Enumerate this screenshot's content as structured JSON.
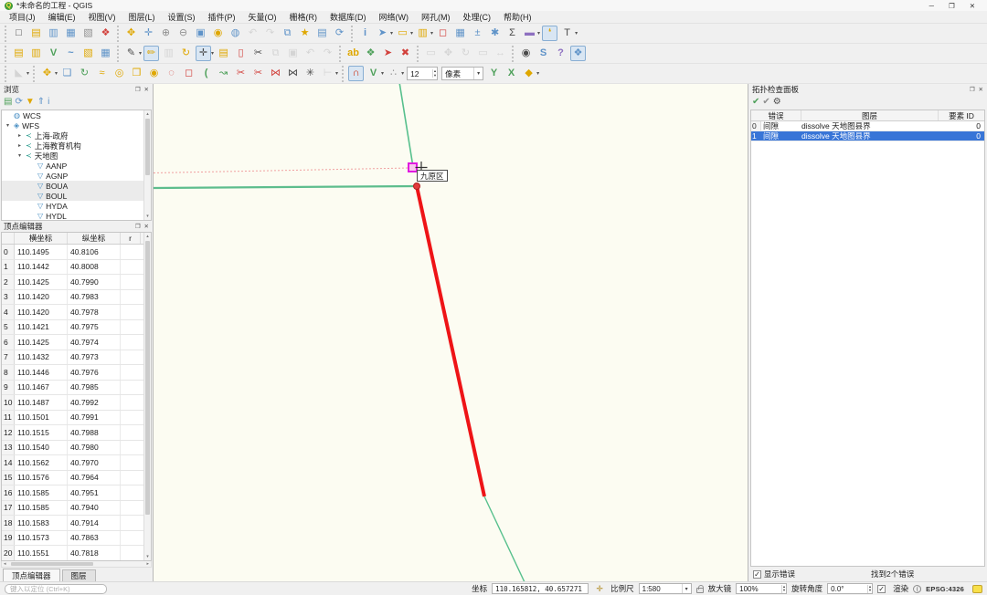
{
  "window": {
    "title": "*未命名的工程 - QGIS",
    "controls": {
      "minimize": "─",
      "maximize": "❐",
      "close": "✕"
    }
  },
  "ui": {
    "dropdown": "▾",
    "up": "▴",
    "down": "▾",
    "left": "◂",
    "right": "▸",
    "expander_open": "▾",
    "expander_closed": "▸",
    "check": "✓",
    "float_glyph": "❐",
    "close_glyph": "✕"
  },
  "palette": {
    "yellow": "#dfa700",
    "blue": "#5f93c8",
    "gray": "#9c9c9c",
    "gray2": "#8f8f8f",
    "dark": "#4a4a4a",
    "red": "#d2413c",
    "red2": "#cc2200",
    "green": "#4ea05a",
    "purple": "#8d6fc0",
    "magenta": "#e01ae0",
    "accent_selection": "#3875d7"
  },
  "menu_bar": [
    "项目(J)",
    "编辑(E)",
    "视图(V)",
    "图层(L)",
    "设置(S)",
    "插件(P)",
    "矢量(O)",
    "栅格(R)",
    "数据库(D)",
    "网络(W)",
    "网孔(M)",
    "处理(C)",
    "帮助(H)"
  ],
  "toolbars": {
    "row1": [
      {
        "name": "project",
        "items": [
          {
            "n": "new-project",
            "g": "□",
            "c": "dark"
          },
          {
            "n": "open-project",
            "g": "▤",
            "c": "yellow"
          },
          {
            "n": "save-project",
            "g": "▥",
            "c": "blue"
          },
          {
            "n": "save-project-as",
            "g": "▦",
            "c": "blue"
          },
          {
            "n": "new-print-layout",
            "g": "▧",
            "c": "gray2"
          },
          {
            "n": "style-manager",
            "g": "❖",
            "c": "red"
          }
        ]
      },
      {
        "name": "navigation",
        "items": [
          {
            "n": "pan-map",
            "g": "✥",
            "c": "yellow"
          },
          {
            "n": "pan-to-selection",
            "g": "✛",
            "c": "blue"
          },
          {
            "n": "zoom-in",
            "g": "⊕",
            "c": "gray2"
          },
          {
            "n": "zoom-out",
            "g": "⊖",
            "c": "gray2"
          },
          {
            "n": "zoom-full",
            "g": "▣",
            "c": "blue"
          },
          {
            "n": "zoom-to-selection",
            "g": "◉",
            "c": "yellow"
          },
          {
            "n": "zoom-to-layer",
            "g": "◍",
            "c": "blue"
          },
          {
            "n": "zoom-last",
            "g": "↶",
            "c": "gray",
            "d": 1
          },
          {
            "n": "zoom-next",
            "g": "↷",
            "c": "gray",
            "d": 1
          },
          {
            "n": "new-map-view",
            "g": "⧉",
            "c": "blue"
          },
          {
            "n": "new-spatial-bookmark",
            "g": "★",
            "c": "yellow"
          },
          {
            "n": "show-bookmarks",
            "g": "▤",
            "c": "blue"
          },
          {
            "n": "refresh-map",
            "g": "⟳",
            "c": "blue"
          }
        ]
      },
      {
        "name": "attributes",
        "items": [
          {
            "n": "identify-features",
            "g": "i",
            "c": "blue",
            "b": 1
          },
          {
            "n": "run-feature-action",
            "g": "➤",
            "c": "blue",
            "dd": 1
          },
          {
            "n": "select-features",
            "g": "▭",
            "c": "yellow",
            "dd": 1
          },
          {
            "n": "select-by-value",
            "g": "▥",
            "c": "yellow",
            "dd": 1
          },
          {
            "n": "deselect-features",
            "g": "◻",
            "c": "red"
          },
          {
            "n": "open-attribute-table",
            "g": "▦",
            "c": "blue"
          },
          {
            "n": "field-calculator",
            "g": "±",
            "c": "blue"
          },
          {
            "n": "processing-toolbox",
            "g": "✱",
            "c": "blue"
          },
          {
            "n": "statistics-panel",
            "g": "Σ",
            "c": "dark"
          },
          {
            "n": "measure",
            "g": "▬",
            "c": "purple",
            "dd": 1
          },
          {
            "n": "map-tips",
            "g": "❛",
            "c": "yellow",
            "a": 1
          },
          {
            "n": "text-annotation",
            "g": "T",
            "c": "dark",
            "dd": 1
          }
        ]
      }
    ],
    "row2": [
      {
        "name": "data-source",
        "items": [
          {
            "n": "new-geopackage-layer",
            "g": "▤",
            "c": "yellow"
          },
          {
            "n": "new-shapefile-layer",
            "g": "▥",
            "c": "yellow"
          },
          {
            "n": "new-virtual-layer",
            "g": "V",
            "c": "green",
            "b": 1
          },
          {
            "n": "new-spatialite-layer",
            "g": "~",
            "c": "blue",
            "b": 1
          },
          {
            "n": "new-temporary-scratch-layer",
            "g": "▧",
            "c": "yellow"
          },
          {
            "n": "new-mesh-layer",
            "g": "▦",
            "c": "blue"
          }
        ]
      },
      {
        "name": "digitizing",
        "items": [
          {
            "n": "current-edits",
            "g": "✎",
            "c": "dark",
            "dd": 1
          },
          {
            "n": "toggle-editing",
            "g": "✏",
            "c": "yellow",
            "a": 1
          },
          {
            "n": "save-layer-edits",
            "g": "▥",
            "c": "gray",
            "d": 1
          },
          {
            "n": "add-line-feature",
            "g": "↻",
            "c": "yellow"
          },
          {
            "n": "vertex-tool",
            "g": "✛",
            "c": "dark",
            "a": 1,
            "dd": 1
          },
          {
            "n": "modify-attributes",
            "g": "▤",
            "c": "yellow"
          },
          {
            "n": "delete-selected",
            "g": "▯",
            "c": "red",
            "b": 1
          },
          {
            "n": "cut-features",
            "g": "✂",
            "c": "dark"
          },
          {
            "n": "copy-features",
            "g": "⧉",
            "c": "gray",
            "d": 1
          },
          {
            "n": "paste-features",
            "g": "▣",
            "c": "gray",
            "d": 1
          },
          {
            "n": "undo",
            "g": "↶",
            "c": "gray",
            "d": 1
          },
          {
            "n": "redo",
            "g": "↷",
            "c": "gray",
            "d": 1
          }
        ]
      },
      {
        "name": "labels",
        "items": [
          {
            "n": "layer-labeling",
            "g": "ab",
            "c": "yellow",
            "b": 1
          },
          {
            "n": "layer-diagram",
            "g": "❖",
            "c": "green"
          },
          {
            "n": "pin-labels",
            "g": "➤",
            "c": "red"
          },
          {
            "n": "unpin-labels",
            "g": "✖",
            "c": "red"
          }
        ]
      },
      {
        "name": "label-tools",
        "items": [
          {
            "n": "highlight-pinned-labels",
            "g": "▭",
            "c": "gray",
            "d": 1
          },
          {
            "n": "move-label",
            "g": "✥",
            "c": "gray",
            "d": 1
          },
          {
            "n": "rotate-label",
            "g": "↻",
            "c": "gray",
            "d": 1
          },
          {
            "n": "change-label-properties",
            "g": "▭",
            "c": "gray",
            "d": 1
          },
          {
            "n": "resize-label",
            "g": "↔",
            "c": "gray",
            "d": 1
          }
        ]
      },
      {
        "name": "plugins",
        "items": [
          {
            "n": "metasearch",
            "g": "◉",
            "c": "dark"
          },
          {
            "n": "python-console",
            "g": "S",
            "c": "blue",
            "b": 1
          },
          {
            "n": "help-contents",
            "g": "?",
            "c": "purple",
            "b": 1
          },
          {
            "n": "topology-checker-plugin",
            "g": "❖",
            "c": "blue",
            "a": 1
          }
        ]
      }
    ],
    "row3": [
      {
        "name": "cad",
        "items": [
          {
            "n": "enable-cad-tools",
            "g": "◣",
            "c": "gray",
            "d": 1,
            "dd": 1
          }
        ]
      },
      {
        "name": "advanced-digitizing",
        "items": [
          {
            "n": "move-feature",
            "g": "✥",
            "c": "yellow",
            "dd": 1
          },
          {
            "n": "copy-and-move-feature",
            "g": "❏",
            "c": "blue"
          },
          {
            "n": "rotate-feature",
            "g": "↻",
            "c": "green"
          },
          {
            "n": "simplify-feature",
            "g": "≈",
            "c": "yellow"
          },
          {
            "n": "add-ring",
            "g": "◎",
            "c": "yellow"
          },
          {
            "n": "add-part",
            "g": "❒",
            "c": "yellow"
          },
          {
            "n": "fill-ring",
            "g": "◉",
            "c": "yellow"
          },
          {
            "n": "delete-ring",
            "g": "◌",
            "c": "red"
          },
          {
            "n": "delete-part",
            "g": "◻",
            "c": "red"
          },
          {
            "n": "offset-curve",
            "g": "(",
            "c": "green",
            "b": 1
          },
          {
            "n": "reshape-features",
            "g": "↝",
            "c": "green"
          },
          {
            "n": "split-parts",
            "g": "✂",
            "c": "red"
          },
          {
            "n": "split-features",
            "g": "✂",
            "c": "red"
          },
          {
            "n": "merge-features",
            "g": "⋈",
            "c": "red"
          },
          {
            "n": "merge-attributes",
            "g": "⋈",
            "c": "dark"
          },
          {
            "n": "rotate-point-symbols",
            "g": "✳",
            "c": "dark"
          },
          {
            "n": "trim-extend",
            "g": "⊢",
            "c": "gray",
            "d": 1,
            "dd": 1
          }
        ]
      },
      {
        "name": "snapping",
        "items": [
          {
            "n": "enable-snapping",
            "g": "∩",
            "c": "red2",
            "a": 1,
            "b": 1
          },
          {
            "n": "snapping-mode",
            "g": "V",
            "c": "green",
            "b": 1,
            "dd": 1
          },
          {
            "n": "snapping-tolerance-type",
            "g": "∴",
            "c": "gray2",
            "dd": 1
          },
          {
            "t": "spin",
            "n": "snapping-tolerance",
            "v": "12"
          },
          {
            "t": "combo",
            "n": "snapping-units",
            "v": "像素"
          },
          {
            "n": "topological-editing",
            "g": "Y",
            "c": "green",
            "b": 1
          },
          {
            "n": "snapping-on-intersection",
            "g": "X",
            "c": "green",
            "b": 1
          },
          {
            "n": "avoid-overlap",
            "g": "◆",
            "c": "yellow",
            "dd": 1
          }
        ]
      }
    ]
  },
  "browser": {
    "title": "浏览",
    "toolbar": [
      {
        "n": "add-selected-layers",
        "g": "▤",
        "c": "green"
      },
      {
        "n": "refresh-browser",
        "g": "⟳",
        "c": "blue"
      },
      {
        "n": "filter-browser",
        "g": "▼",
        "c": "yellow"
      },
      {
        "n": "collapse-all",
        "g": "⇑",
        "c": "blue"
      },
      {
        "n": "properties-widget",
        "g": "i",
        "c": "blue"
      }
    ],
    "icon_map": {
      "globe": {
        "g": "◍",
        "c": "#4a90c4"
      },
      "wfs": {
        "g": "◈",
        "c": "#4a90c4"
      },
      "conn": {
        "g": "≺",
        "c": "#2d9d8f"
      },
      "layer": {
        "g": "▽",
        "c": "#4a90c4"
      }
    },
    "items": [
      {
        "label": "WCS",
        "depth": 0,
        "icon": "globe",
        "exp": ""
      },
      {
        "label": "WFS",
        "depth": 0,
        "icon": "wfs",
        "exp": "open"
      },
      {
        "label": "上海-政府",
        "depth": 1,
        "icon": "conn",
        "exp": "closed"
      },
      {
        "label": "上海教育机构",
        "depth": 1,
        "icon": "conn",
        "exp": "closed"
      },
      {
        "label": "天地图",
        "depth": 1,
        "icon": "conn",
        "exp": "open"
      },
      {
        "label": "AANP",
        "depth": 2,
        "icon": "layer",
        "exp": ""
      },
      {
        "label": "AGNP",
        "depth": 2,
        "icon": "layer",
        "exp": ""
      },
      {
        "label": "BOUA",
        "depth": 2,
        "icon": "layer",
        "exp": "",
        "selected": true
      },
      {
        "label": "BOUL",
        "depth": 2,
        "icon": "layer",
        "exp": "",
        "selected": true
      },
      {
        "label": "HYDA",
        "depth": 2,
        "icon": "layer",
        "exp": ""
      },
      {
        "label": "HYDL",
        "depth": 2,
        "icon": "layer",
        "exp": ""
      }
    ]
  },
  "vertex_editor": {
    "title": "顶点编辑器",
    "columns": [
      "",
      "横坐标",
      "纵坐标",
      "r"
    ],
    "rows": [
      [
        "0",
        "110.1495",
        "40.8106"
      ],
      [
        "1",
        "110.1442",
        "40.8008"
      ],
      [
        "2",
        "110.1425",
        "40.7990"
      ],
      [
        "3",
        "110.1420",
        "40.7983"
      ],
      [
        "4",
        "110.1420",
        "40.7978"
      ],
      [
        "5",
        "110.1421",
        "40.7975"
      ],
      [
        "6",
        "110.1425",
        "40.7974"
      ],
      [
        "7",
        "110.1432",
        "40.7973"
      ],
      [
        "8",
        "110.1446",
        "40.7976"
      ],
      [
        "9",
        "110.1467",
        "40.7985"
      ],
      [
        "10",
        "110.1487",
        "40.7992"
      ],
      [
        "11",
        "110.1501",
        "40.7991"
      ],
      [
        "12",
        "110.1515",
        "40.7988"
      ],
      [
        "13",
        "110.1540",
        "40.7980"
      ],
      [
        "14",
        "110.1562",
        "40.7970"
      ],
      [
        "15",
        "110.1576",
        "40.7964"
      ],
      [
        "16",
        "110.1585",
        "40.7951"
      ],
      [
        "17",
        "110.1585",
        "40.7940"
      ],
      [
        "18",
        "110.1583",
        "40.7914"
      ],
      [
        "19",
        "110.1573",
        "40.7863"
      ],
      [
        "20",
        "110.1551",
        "40.7818"
      ]
    ]
  },
  "tabs": [
    {
      "label": "顶点编辑器",
      "active": true
    },
    {
      "label": "图层",
      "active": false
    }
  ],
  "locator": {
    "placeholder": "键入以定位 (Ctrl+K)"
  },
  "map": {
    "tooltip": "九原区",
    "background": "#fcfcf2",
    "line_green": "#57c08d",
    "line_red": "#ee1417",
    "line_dashed_pink": "#f0a0a0",
    "marker_magenta": "#e01ae0"
  },
  "topology": {
    "title": "拓扑检查面板",
    "toolbar": [
      {
        "n": "validate-all",
        "g": "✔",
        "c": "green"
      },
      {
        "n": "validate-extent",
        "g": "✔",
        "c": "gray2"
      },
      {
        "n": "configure",
        "g": "⚙",
        "c": "dark"
      }
    ],
    "columns": [
      "错误",
      "图层",
      "要素 ID"
    ],
    "rows": [
      {
        "n": "0",
        "error": "间隙",
        "layer": "dissolve 天地图县界",
        "feature_id": "0",
        "selected": false
      },
      {
        "n": "1",
        "error": "间隙",
        "layer": "dissolve 天地图县界",
        "feature_id": "0",
        "selected": true
      }
    ],
    "show_errors_label": "显示错误",
    "found_label": "找到2个错误"
  },
  "status_bar": {
    "coord_label": "坐标",
    "coordinate": "110.165812, 40.657271",
    "scale_label": "比例尺",
    "scale": "1:580",
    "magnifier_label": "放大镜",
    "magnifier": "100%",
    "rotation_label": "旋转角度",
    "rotation": "0.0°",
    "render_label": "渲染",
    "crs": "EPSG:4326"
  }
}
